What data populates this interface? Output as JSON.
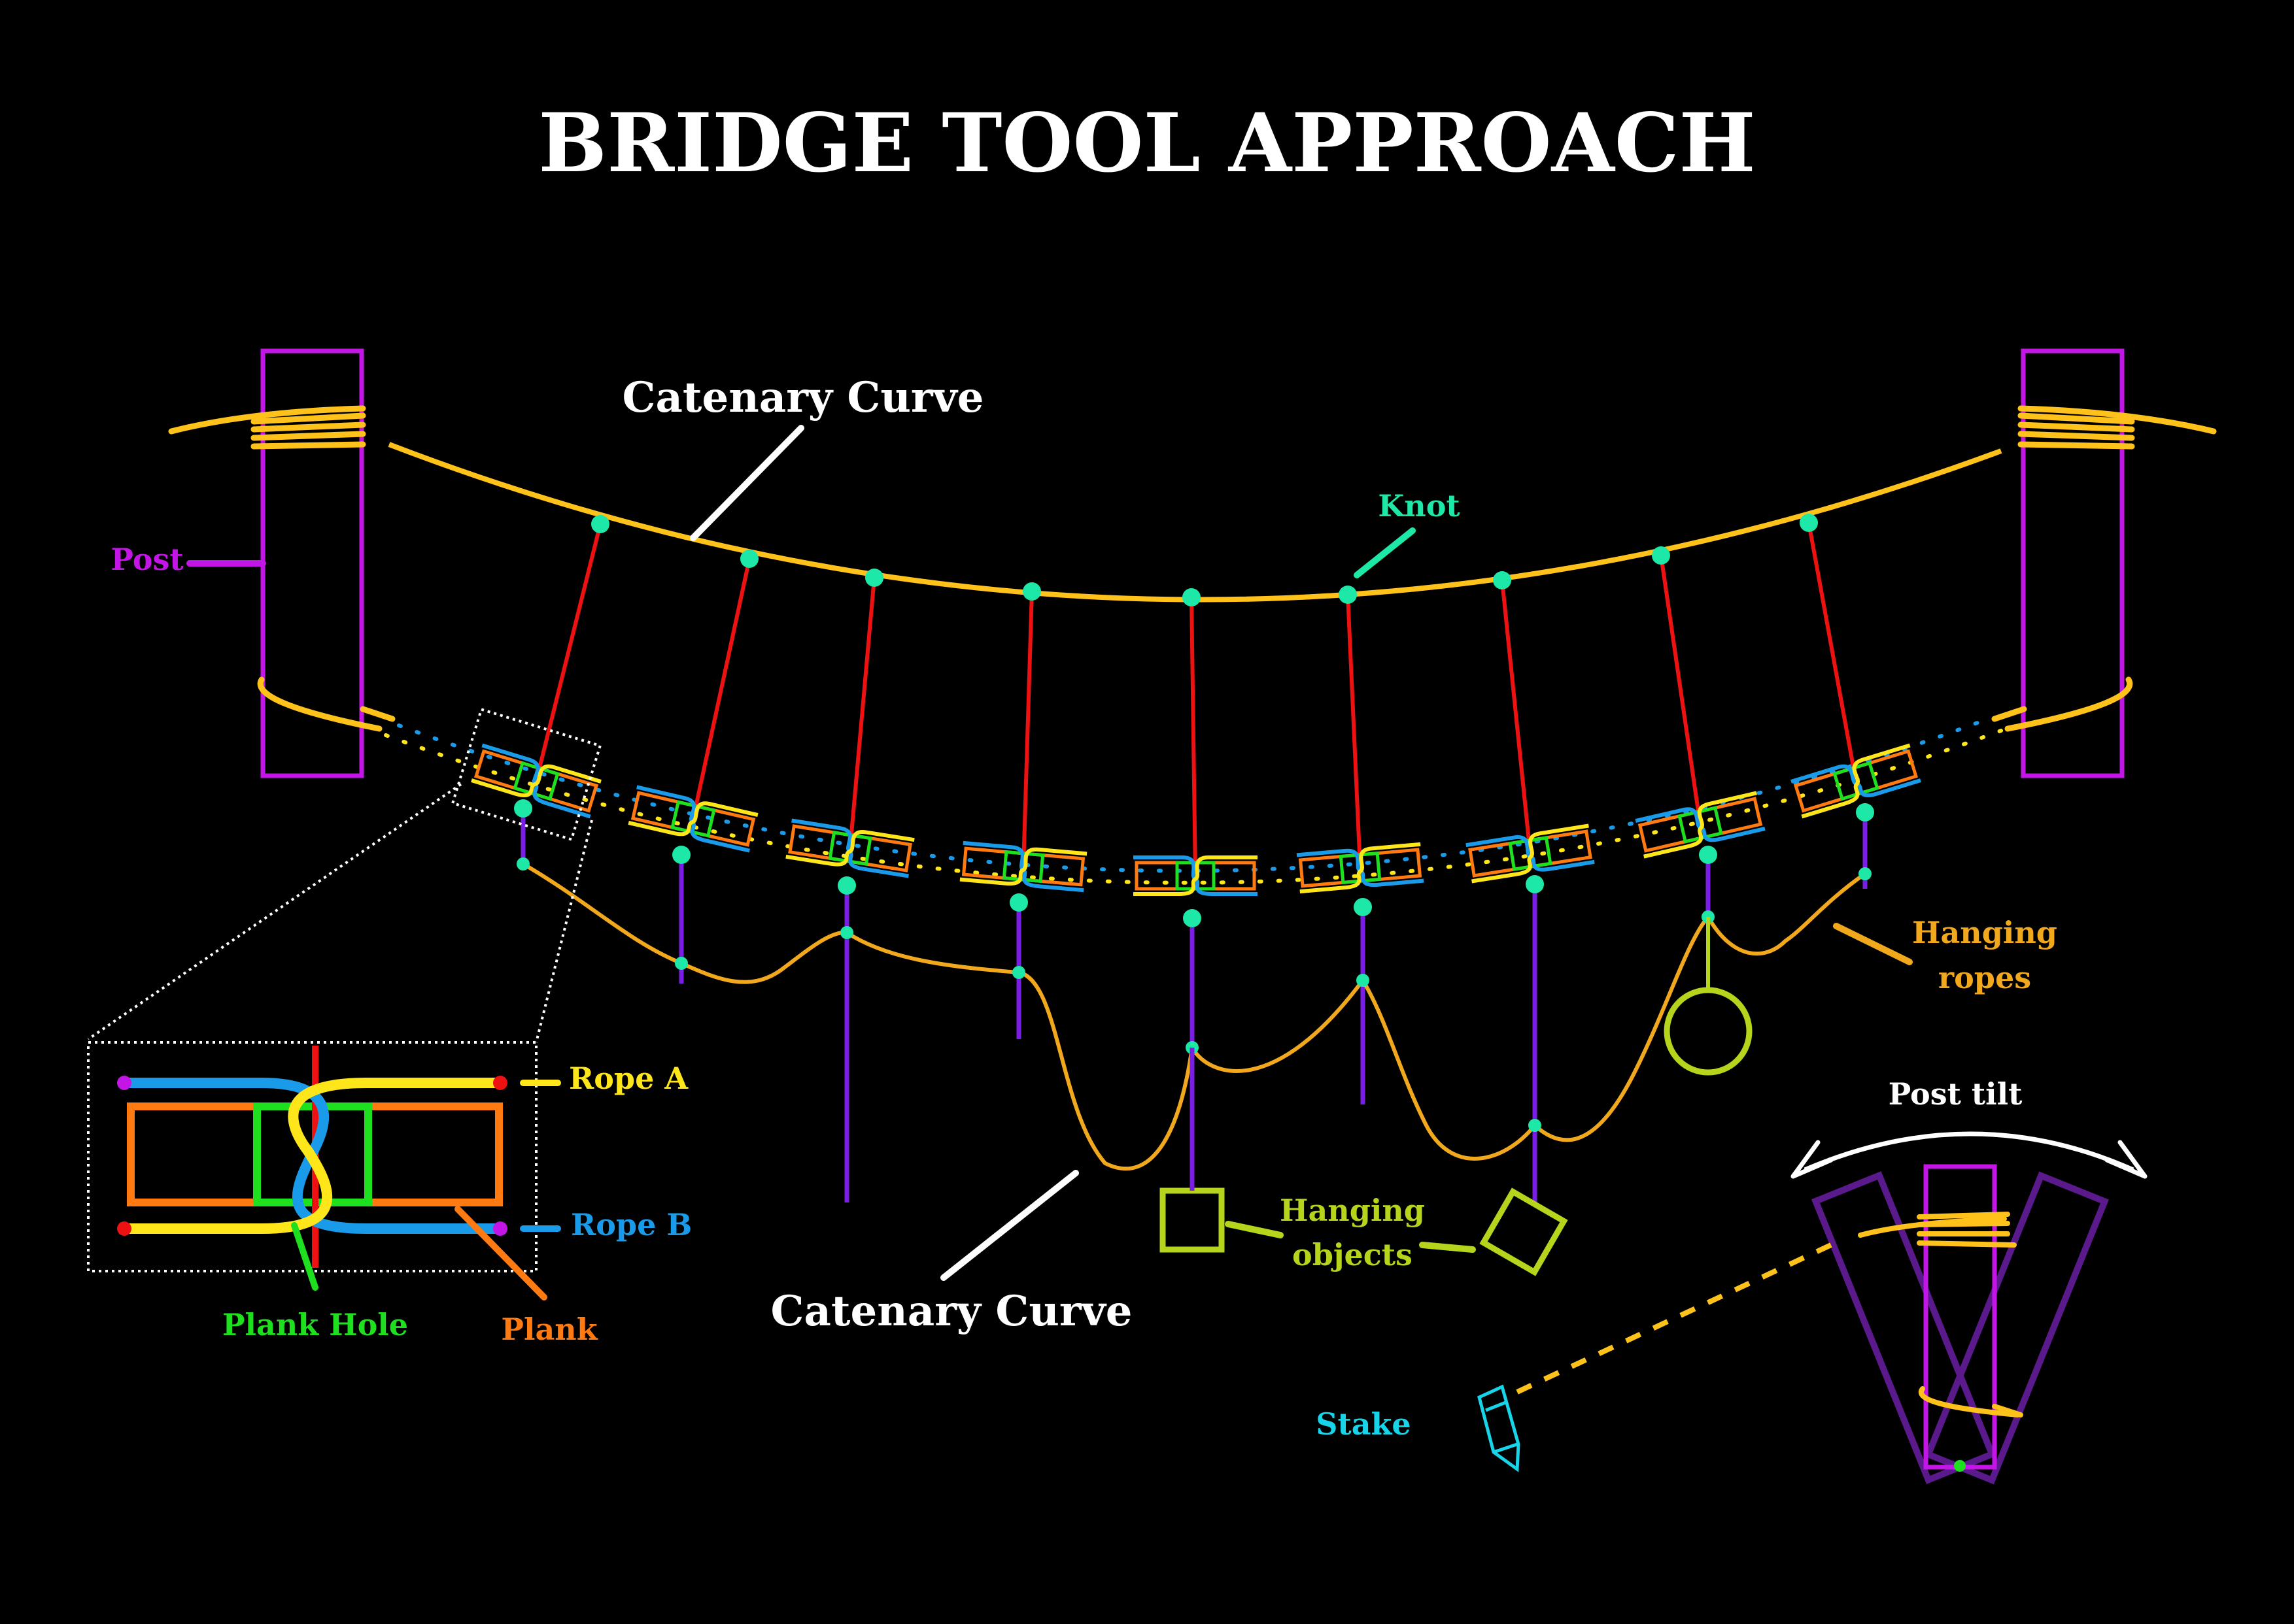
{
  "title": "BRIDGE TOOL APPROACH",
  "labels": {
    "catenary_top": "Catenary Curve",
    "catenary_bottom": "Catenary Curve",
    "post": "Post",
    "knot": "Knot",
    "hanging_ropes_1": "Hanging",
    "hanging_ropes_2": "ropes",
    "hanging_objects_1": "Hanging",
    "hanging_objects_2": "objects",
    "rope_a": "Rope A",
    "rope_b": "Rope B",
    "plank_hole": "Plank Hole",
    "plank": "Plank",
    "post_tilt": "Post tilt",
    "stake": "Stake"
  },
  "colors": {
    "background": "#000000",
    "title": "#ffffff",
    "catenary": "#ffc21a",
    "post": "#c316e6",
    "knot": "#1ee8a8",
    "suspender": "#ee1111",
    "hanger": "#7a1ee6",
    "hanging_rope": "#f2a81c",
    "hanging_object": "#b5d41c",
    "rope_a": "#ffe61a",
    "rope_b": "#1a9bea",
    "plank": "#ff7a10",
    "plank_hole": "#1ee01e",
    "stake": "#18d4e8",
    "post_tilt_ghost": "#5a1a8c"
  },
  "icons": {
    "stake": "stake-icon",
    "hanging_circle": "circle-object-icon",
    "hanging_square": "square-object-icon",
    "hanging_diamond": "diamond-object-icon",
    "tilt_arrow": "double-arrow-icon"
  }
}
